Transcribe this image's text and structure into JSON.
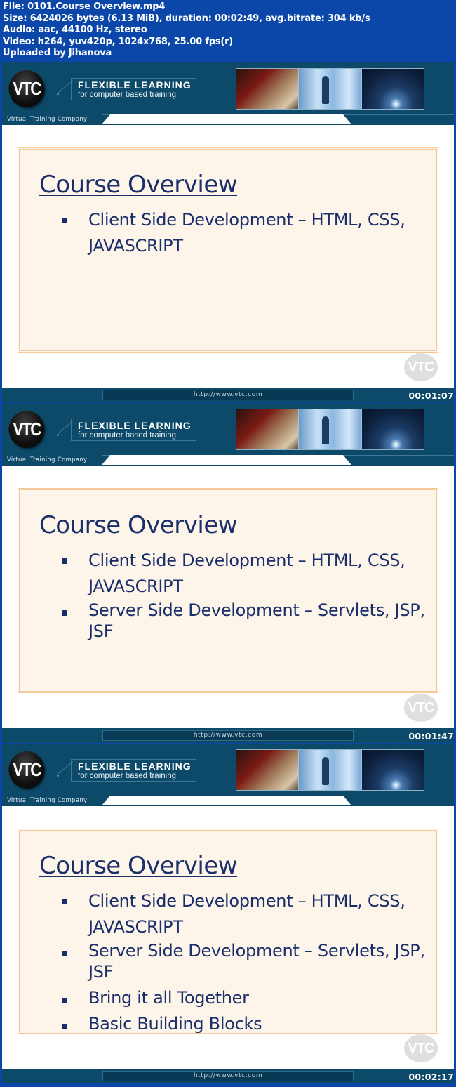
{
  "info": {
    "file": "File: 0101.Course Overview.mp4",
    "size": "Size: 6424026 bytes (6.13 MiB), duration: 00:02:49, avg.bitrate: 304 kb/s",
    "audio": "Audio: aac, 44100 Hz, stereo",
    "video": "Video: h264, yuv420p, 1024x768, 25.00 fps(r)",
    "uploader": "Uploaded by Jihanova"
  },
  "brand": {
    "logo": "VTC",
    "tagline_main": "FLEXIBLE LEARNING",
    "tagline_sub": "for computer based training",
    "company": "Virtual Training Company",
    "url": "http://www.vtc.com",
    "watermark": "VTC"
  },
  "frames": [
    {
      "timestamp": "00:01:07",
      "title": "Course Overview",
      "bullets": [
        "Client Side Development – HTML, CSS, JAVASCRIPT"
      ]
    },
    {
      "timestamp": "00:01:47",
      "title": "Course Overview",
      "bullets": [
        "Client Side Development – HTML, CSS, JAVASCRIPT",
        "Server Side Development – Servlets, JSP, JSF"
      ]
    },
    {
      "timestamp": "00:02:17",
      "title": "Course Overview",
      "bullets": [
        "Client Side Development – HTML, CSS, JAVASCRIPT",
        "Server Side Development – Servlets, JSP, JSF",
        "Bring it all Together",
        "Basic Building Blocks"
      ]
    }
  ]
}
